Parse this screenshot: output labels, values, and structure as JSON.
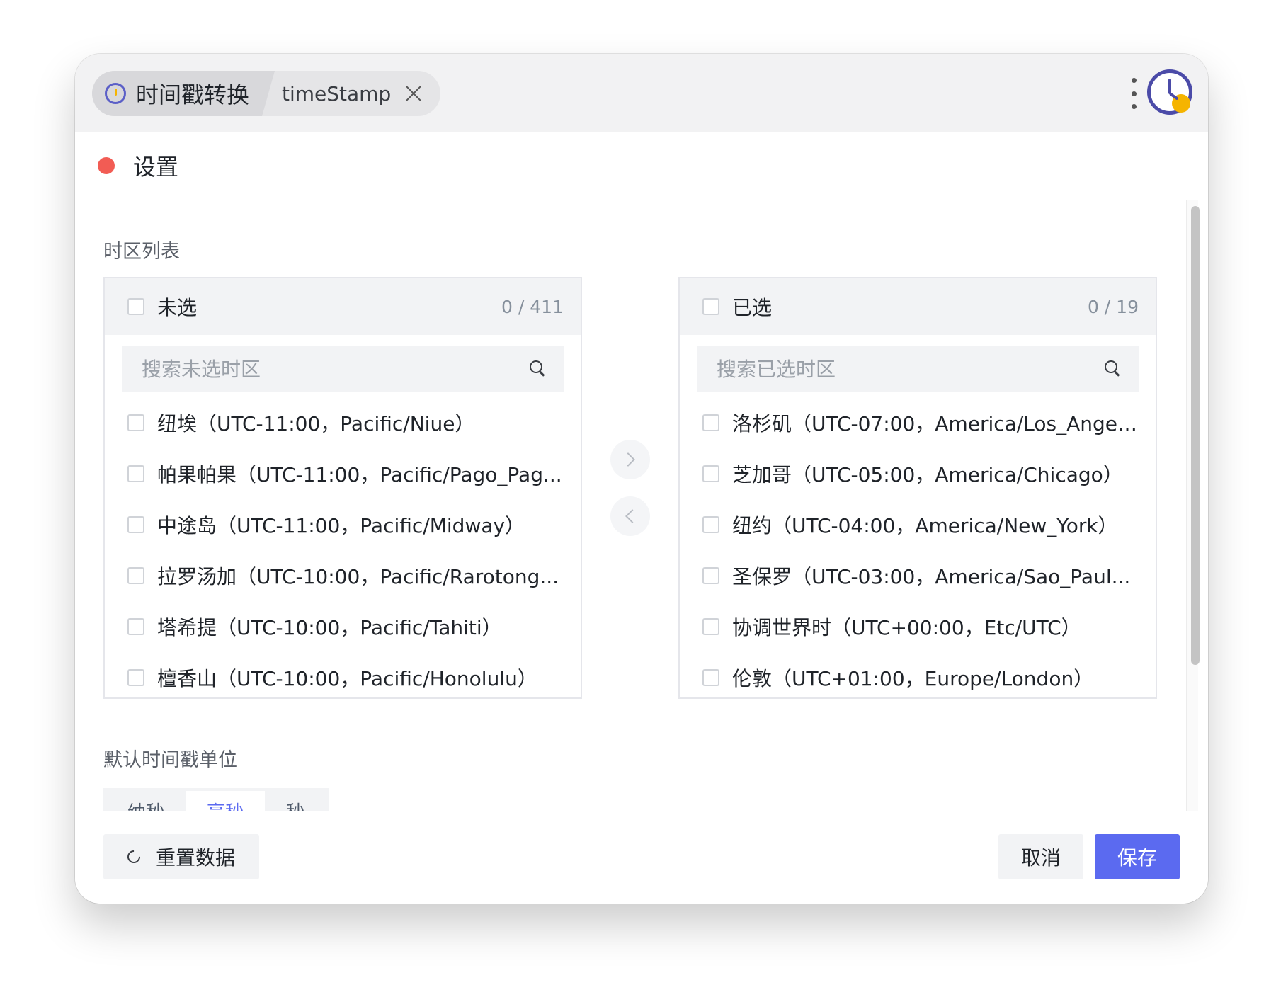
{
  "window": {
    "tabs": {
      "main_label": "时间戳转换",
      "main_icon": "clock-icon",
      "sub_label": "timeStamp"
    },
    "menu_icon": "more-vertical-icon",
    "app_icon": "clock-logo-icon"
  },
  "settings": {
    "title": "设置",
    "status_color": "#f25c54"
  },
  "timezone": {
    "section_title": "时区列表",
    "unselected": {
      "title": "未选",
      "count": "0 / 411",
      "search_placeholder": "搜索未选时区",
      "items": [
        {
          "label": "纽埃（UTC-11:00，Pacific/Niue）"
        },
        {
          "label": "帕果帕果（UTC-11:00，Pacific/Pago_Pag..."
        },
        {
          "label": "中途岛（UTC-11:00，Pacific/Midway）"
        },
        {
          "label": "拉罗汤加（UTC-10:00，Pacific/Rarotong..."
        },
        {
          "label": "塔希提（UTC-10:00，Pacific/Tahiti）"
        },
        {
          "label": "檀香山（UTC-10:00，Pacific/Honolulu）"
        }
      ]
    },
    "selected": {
      "title": "已选",
      "count": "0 / 19",
      "search_placeholder": "搜索已选时区",
      "items": [
        {
          "label": "洛杉矶（UTC-07:00，America/Los_Angel..."
        },
        {
          "label": "芝加哥（UTC-05:00，America/Chicago）"
        },
        {
          "label": "纽约（UTC-04:00，America/New_York）"
        },
        {
          "label": "圣保罗（UTC-03:00，America/Sao_Paul..."
        },
        {
          "label": "协调世界时（UTC+00:00，Etc/UTC）"
        },
        {
          "label": "伦敦（UTC+01:00，Europe/London）"
        }
      ]
    }
  },
  "unit": {
    "section_title": "默认时间戳单位",
    "options": [
      "纳秒",
      "毫秒",
      "秒"
    ],
    "selected": "毫秒",
    "accent_color": "#5b6af0"
  },
  "footer": {
    "reset_label": "重置数据",
    "cancel_label": "取消",
    "save_label": "保存"
  }
}
